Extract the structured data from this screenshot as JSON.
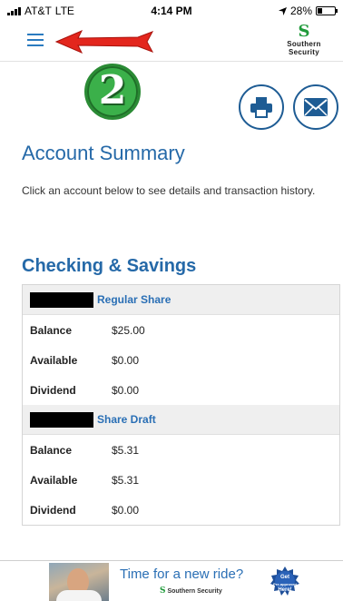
{
  "status_bar": {
    "carrier": "AT&T",
    "network": "LTE",
    "time": "4:14 PM",
    "battery": "28%",
    "battery_level": 0.28
  },
  "header": {
    "menu_icon": "hamburger-menu-icon",
    "logo_line1": "Southern",
    "logo_line2": "Security",
    "annotation_color": "#e3261d"
  },
  "step_badge": {
    "number": "2",
    "color": "#3bb04a"
  },
  "actions": {
    "print_icon": "printer-icon",
    "mail_icon": "envelope-icon",
    "color": "#1e5c94"
  },
  "main": {
    "title": "Account Summary",
    "intro": "Click an account below to see details and transaction history.",
    "section_title": "Checking & Savings"
  },
  "accounts": [
    {
      "name": "Regular Share",
      "rows": [
        {
          "label": "Balance",
          "value": "$25.00"
        },
        {
          "label": "Available",
          "value": "$0.00"
        },
        {
          "label": "Dividend",
          "value": "$0.00"
        }
      ]
    },
    {
      "name": "Share Draft",
      "rows": [
        {
          "label": "Balance",
          "value": "$5.31"
        },
        {
          "label": "Available",
          "value": "$5.31"
        },
        {
          "label": "Dividend",
          "value": "$0.00"
        }
      ]
    }
  ],
  "ad": {
    "headline": "Time for a new ride?",
    "brand": "Southern Security",
    "seal_line1": "Get",
    "seal_line2": "Pre-approved",
    "seal_line3": "Here!"
  },
  "colors": {
    "accent": "#2569a8",
    "brand_green": "#1f9a3a"
  }
}
